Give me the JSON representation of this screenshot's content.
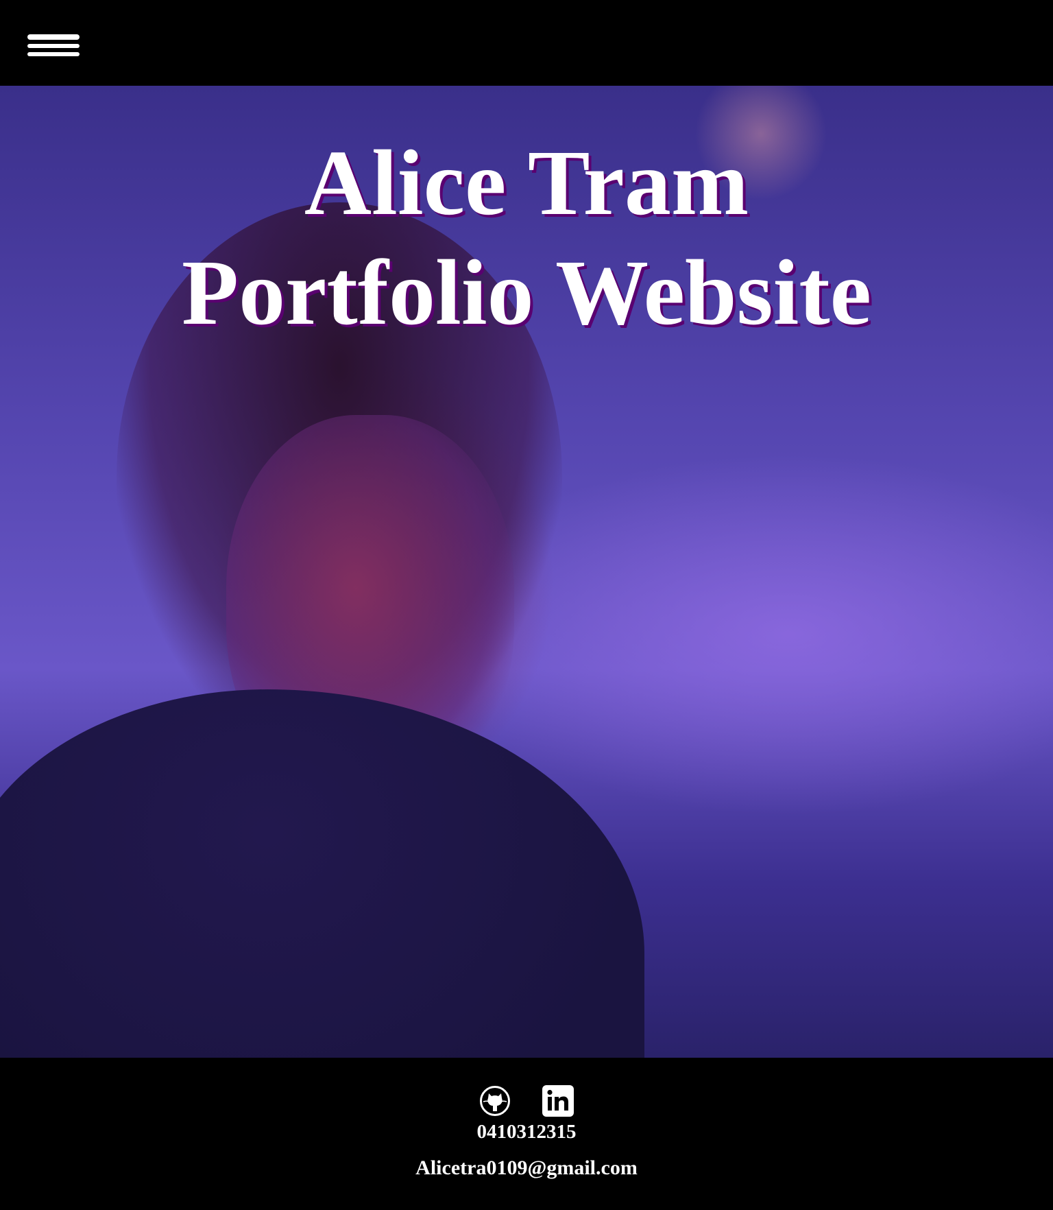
{
  "header": {
    "menu_icon": "hamburger-menu-icon"
  },
  "hero": {
    "title_line1": "Alice Tram",
    "title_line2": "Portfolio Website",
    "shadow_color": "#5a0070"
  },
  "footer": {
    "icons": [
      "github-icon",
      "linkedin-icon"
    ],
    "phone": "0410312315",
    "email": "Alicetra0109@gmail.com"
  }
}
